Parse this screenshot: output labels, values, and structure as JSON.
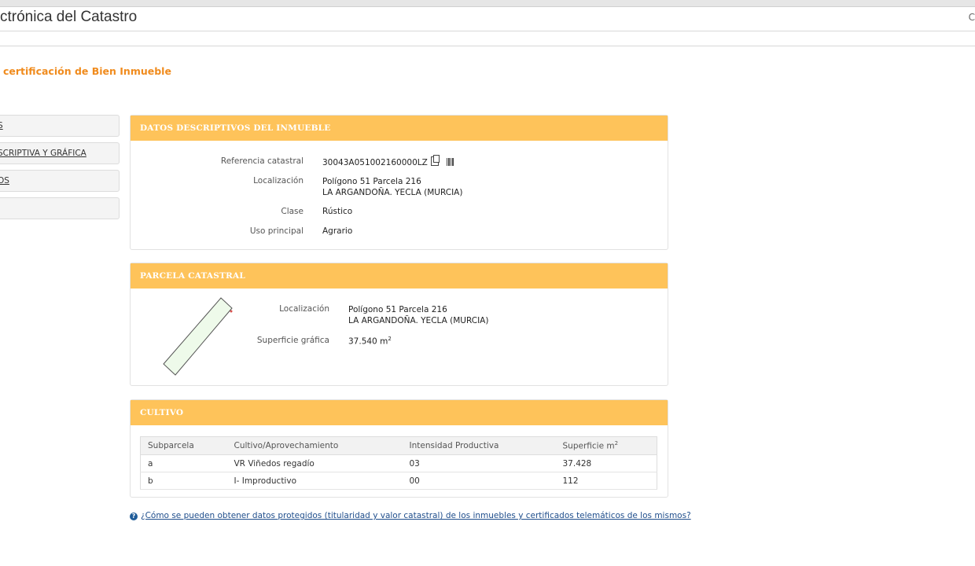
{
  "header": {
    "site_title": "ctrónica del Catastro",
    "edge_glyph": "C"
  },
  "page_title": "certificación de Bien Inmueble",
  "sidebar": {
    "items": [
      {
        "label": "S"
      },
      {
        "label": "SCRIPTIVA Y GRÁFICA"
      },
      {
        "label": "OS"
      },
      {
        "label": ""
      }
    ]
  },
  "datos": {
    "heading": "DATOS DESCRIPTIVOS DEL INMUEBLE",
    "ref_label": "Referencia catastral",
    "ref_value": "30043A051002160000LZ",
    "loc_label": "Localización",
    "loc_line1": "Polígono 51 Parcela 216",
    "loc_line2": "LA ARGANDOÑA. YECLA (MURCIA)",
    "clase_label": "Clase",
    "clase_value": "Rústico",
    "uso_label": "Uso principal",
    "uso_value": "Agrario"
  },
  "parcela": {
    "heading": "PARCELA CATASTRAL",
    "loc_label": "Localización",
    "loc_line1": "Polígono 51 Parcela 216",
    "loc_line2": "LA ARGANDOÑA. YECLA (MURCIA)",
    "sup_label": "Superficie gráfica",
    "sup_value": "37.540 m",
    "sup_unit_exp": "2"
  },
  "cultivo": {
    "heading": "CULTIVO",
    "columns": [
      "Subparcela",
      "Cultivo/Aprovechamiento",
      "Intensidad Productiva",
      "Superficie m"
    ],
    "col_sup_exp": "2",
    "rows": [
      [
        "a",
        "VR Viñedos regadío",
        "03",
        "37.428"
      ],
      [
        "b",
        "I- Improductivo",
        "00",
        "112"
      ]
    ]
  },
  "faq_text": "¿Cómo se pueden obtener datos protegidos (titularidad y valor catastral) de los inmuebles y certificados telemáticos de los mismos?",
  "colors": {
    "accent_orange": "#f08b1d",
    "panel_header": "#fec35a",
    "parcel_fill": "#eefaea"
  }
}
